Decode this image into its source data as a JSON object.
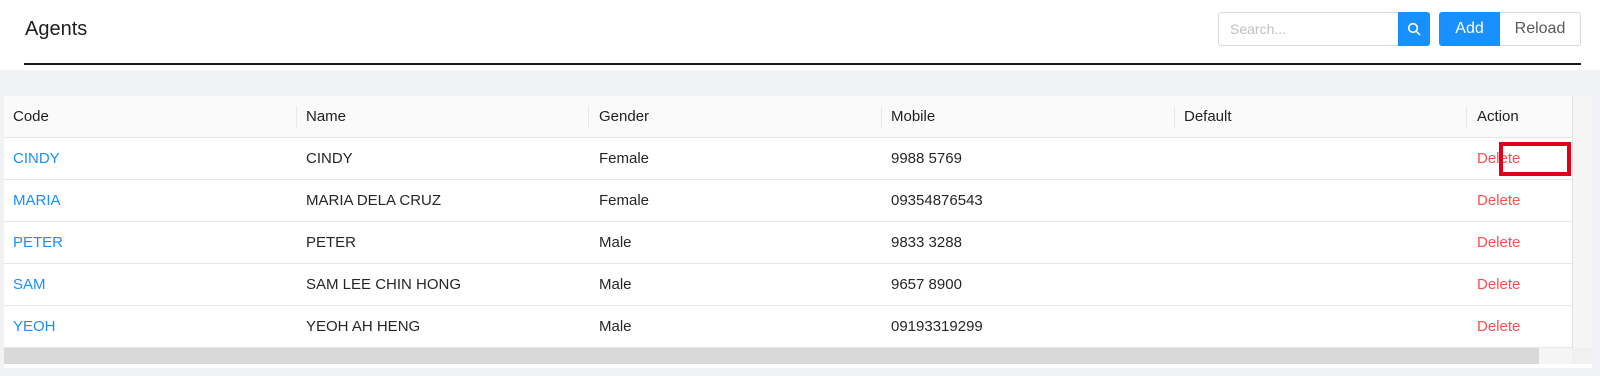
{
  "header": {
    "title": "Agents",
    "search": {
      "placeholder": "Search...",
      "value": ""
    },
    "search_icon": "search-icon",
    "add_label": "Add",
    "reload_label": "Reload"
  },
  "table": {
    "columns": [
      "Code",
      "Name",
      "Gender",
      "Mobile",
      "Default",
      "Action"
    ],
    "rows": [
      {
        "code": "CINDY",
        "name": "CINDY",
        "gender": "Female",
        "mobile": "9988 5769",
        "default": "",
        "action": "Delete"
      },
      {
        "code": "MARIA",
        "name": "MARIA DELA CRUZ",
        "gender": "Female",
        "mobile": "09354876543",
        "default": "",
        "action": "Delete"
      },
      {
        "code": "PETER",
        "name": "PETER",
        "gender": "Male",
        "mobile": "9833 3288",
        "default": "",
        "action": "Delete"
      },
      {
        "code": "SAM",
        "name": "SAM LEE CHIN HONG",
        "gender": "Male",
        "mobile": "9657 8900",
        "default": "",
        "action": "Delete"
      },
      {
        "code": "YEOH",
        "name": "YEOH AH HENG",
        "gender": "Male",
        "mobile": "09193319299",
        "default": "",
        "action": "Delete"
      }
    ]
  },
  "colors": {
    "primary": "#1890ff",
    "danger": "#ff4d4f",
    "highlight_box": "#e0001b",
    "page_background": "#f0f2f5"
  }
}
